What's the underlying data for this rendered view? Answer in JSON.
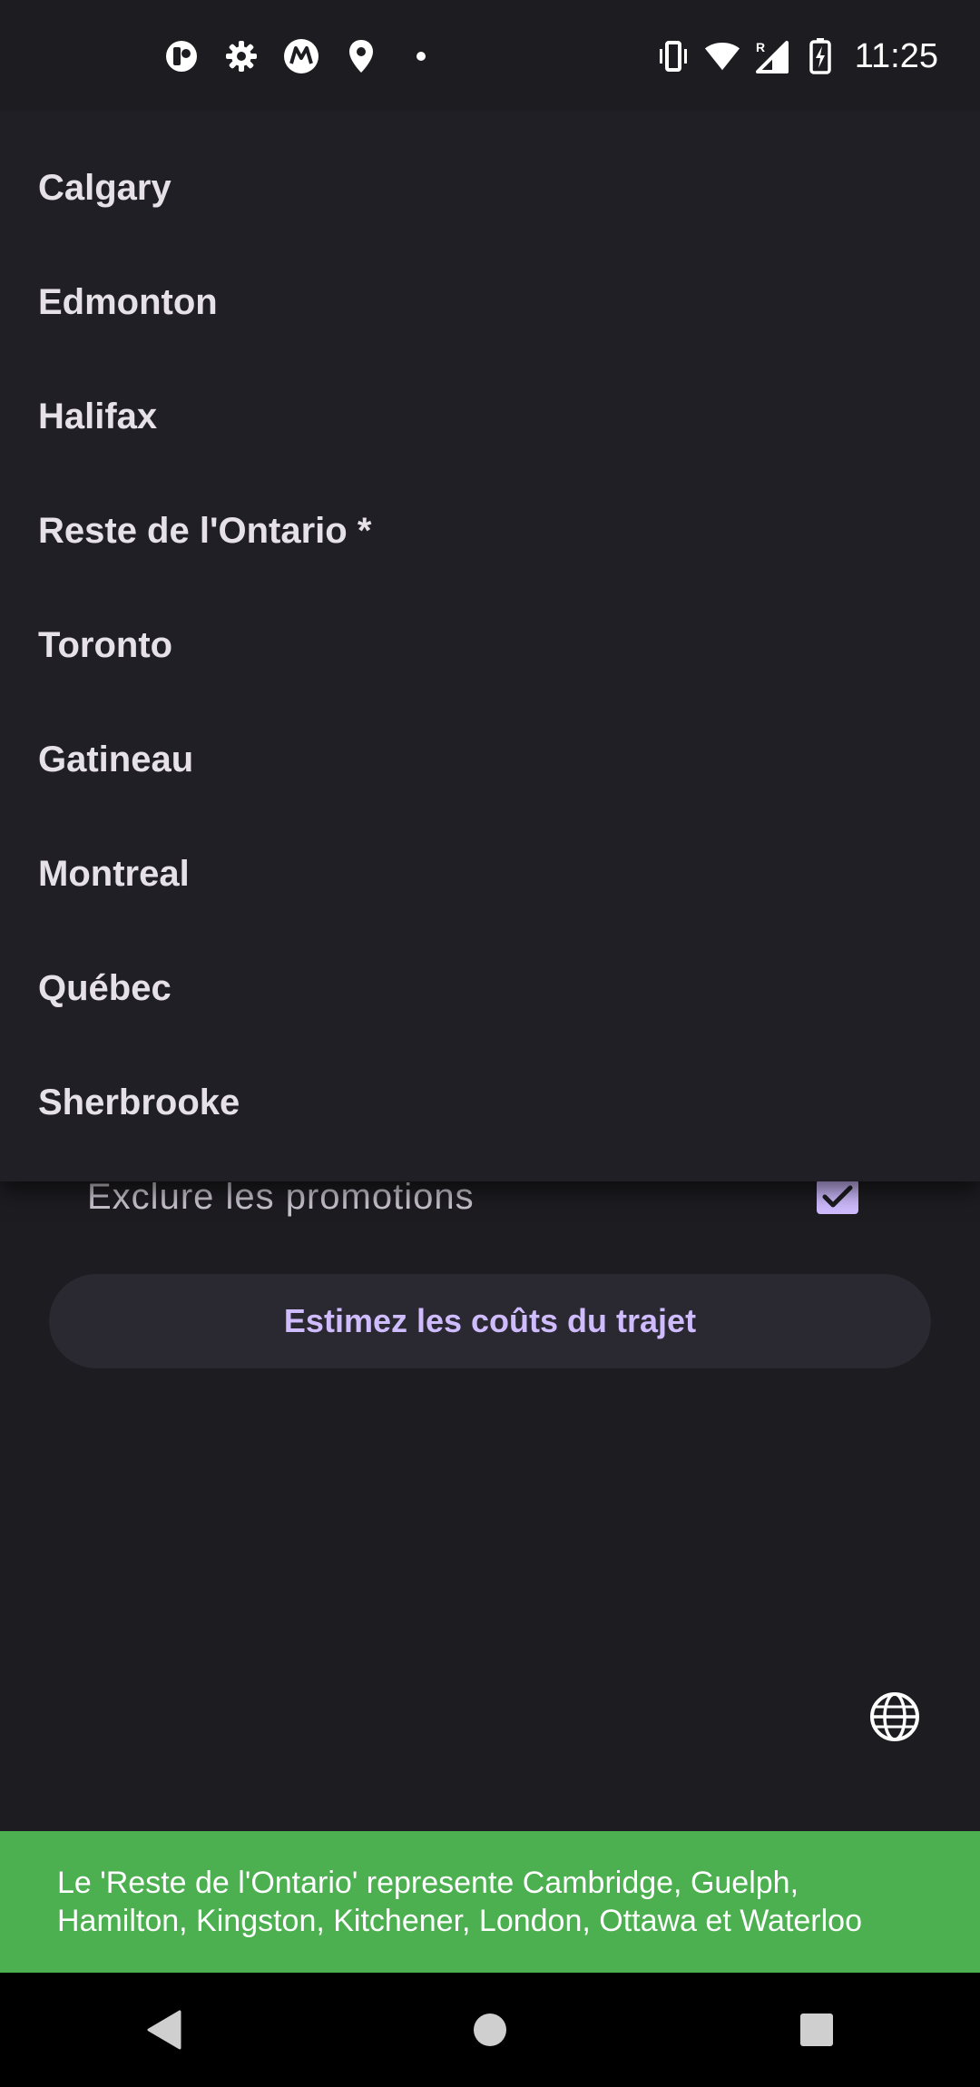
{
  "status_bar": {
    "time": "11:25",
    "left_icons": [
      "lock-circle-icon",
      "gear-icon",
      "motorola-icon",
      "location-pin-icon",
      "dot-icon"
    ],
    "right_icons": [
      "vibrate-icon",
      "wifi-icon",
      "signal-roaming-icon",
      "battery-charging-icon"
    ]
  },
  "city_menu": {
    "items": [
      {
        "label": "Calgary"
      },
      {
        "label": "Edmonton"
      },
      {
        "label": "Halifax"
      },
      {
        "label": "Reste de l'Ontario *"
      },
      {
        "label": "Toronto"
      },
      {
        "label": "Gatineau"
      },
      {
        "label": "Montreal"
      },
      {
        "label": "Québec"
      },
      {
        "label": "Sherbrooke"
      }
    ]
  },
  "form": {
    "exclude_promotions_label": "Exclure les promotions",
    "exclude_promotions_checked": true,
    "estimate_button_label": "Estimez les coûts du trajet"
  },
  "snackbar": {
    "line1": "Le 'Reste de l'Ontario' represente Cambridge, Guelph,",
    "line2": "Hamilton, Kingston, Kitchener, London, Ottawa et Waterloo"
  },
  "colors": {
    "background": "#1d1c21",
    "menu_background": "#211f26",
    "accent": "#cfbcff",
    "snackbar": "#4caf50"
  }
}
